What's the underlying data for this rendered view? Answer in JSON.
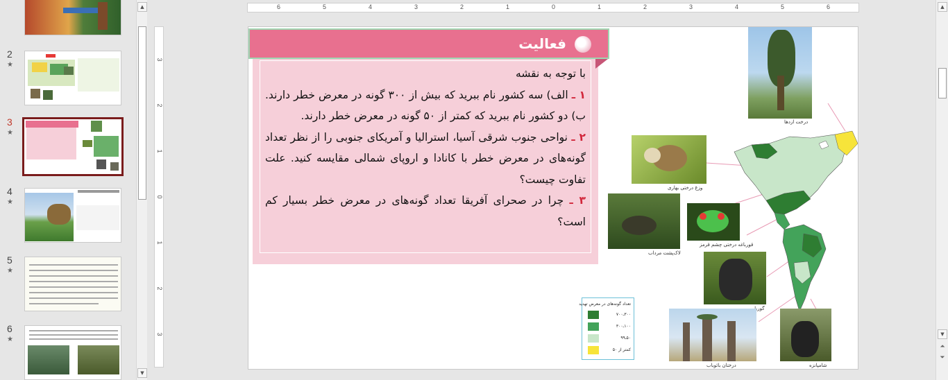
{
  "thumbnails": [
    {
      "number": "",
      "star": "",
      "kind": "partial"
    },
    {
      "number": "2",
      "star": "★",
      "kind": "map"
    },
    {
      "number": "3",
      "star": "★",
      "kind": "current"
    },
    {
      "number": "4",
      "star": "★",
      "kind": "landscape"
    },
    {
      "number": "5",
      "star": "★",
      "kind": "text"
    },
    {
      "number": "6",
      "star": "★",
      "kind": "photos"
    }
  ],
  "ruler": {
    "horizontal": [
      "6",
      "5",
      "4",
      "3",
      "2",
      "1",
      "0",
      "1",
      "2",
      "3",
      "4",
      "5",
      "6"
    ],
    "vertical": [
      "3",
      "2",
      "1",
      "0",
      "1",
      "2",
      "3"
    ]
  },
  "slide": {
    "title": "فعالیت",
    "intro": "با توجه به نقشه",
    "q1_num": "۱ ـ",
    "q1_text": "الف) سه کشور نام ببرید که بیش از ۳۰۰ گونه در معرض خطر دارند. ب) دو کشور نام ببرید که کمتر از ۵۰ گونه در معرض خطر دارند.",
    "q2_num": "۲ ـ",
    "q2_text": "نواحی جنوب شرقی آسیا، استرالیا و آمریکای جنوبی را از نظر تعداد گونه‌های در معرض خطر با کانادا و اروپای شمالی مقایسه کنید. علت تفاوت چیست؟",
    "q3_num": "۳ ـ",
    "q3_text": "چرا در صحرای آفریقا تعداد گونه‌های در معرض خطر بسیار کم است؟"
  },
  "map": {
    "captions": {
      "tree": "درخت ازدها",
      "frog1": "وزغ درختی بهاری",
      "turtle": "لاک‌پشت مرداب",
      "frog2": "قورباغه درختی چشم قرمز",
      "gorilla": "گوریل",
      "baobab": "درختان بائوباب",
      "chimp": "شامپانزه"
    },
    "legend": {
      "title": "تعداد گونه‌های در معرض تهدید",
      "items": [
        {
          "label": "۳۰۰ـ۷۰۰",
          "color": "#2e7d32"
        },
        {
          "label": "۱۰۰ـ۳۰۰",
          "color": "#43a35a"
        },
        {
          "label": "۵۰ـ۹۹",
          "color": "#c8e6c9"
        },
        {
          "label": "کمتر از ۵۰",
          "color": "#f7e43a"
        }
      ]
    }
  },
  "colors": {
    "banner": "#e8708f",
    "panel": "#f6cfd9",
    "number_red": "#d1263a",
    "selected_border": "#7a1c1c"
  }
}
